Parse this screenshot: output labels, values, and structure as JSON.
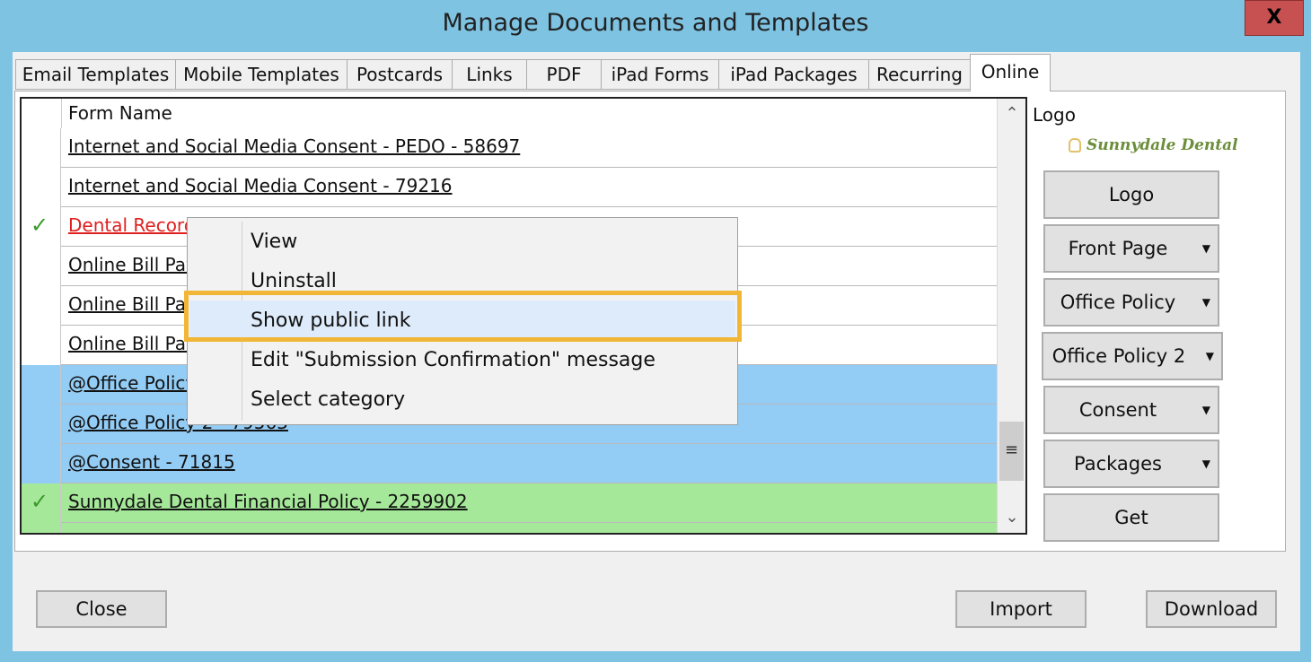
{
  "window": {
    "title": "Manage Documents and Templates",
    "close_glyph": "X"
  },
  "tabs": [
    {
      "label": "Email Templates"
    },
    {
      "label": "Mobile Templates"
    },
    {
      "label": "Postcards"
    },
    {
      "label": "Links"
    },
    {
      "label": "PDF"
    },
    {
      "label": "iPad Forms"
    },
    {
      "label": "iPad Packages"
    },
    {
      "label": "Recurring"
    },
    {
      "label": "Online",
      "active": true
    }
  ],
  "grid": {
    "header": "Form Name",
    "rows": [
      {
        "name": "Internet and Social Media Consent - PEDO - 58697",
        "style": "normal",
        "checked": false
      },
      {
        "name": "Internet and Social Media Consent - 79216",
        "style": "normal",
        "checked": false
      },
      {
        "name": "Dental Record",
        "style": "red",
        "checked": true
      },
      {
        "name": "Online Bill Pay",
        "style": "normal",
        "checked": false
      },
      {
        "name": "Online Bill Pay",
        "style": "normal",
        "checked": false
      },
      {
        "name": "Online Bill Pay",
        "style": "normal",
        "checked": false
      },
      {
        "name": "@Office Policy",
        "style": "blue",
        "checked": false
      },
      {
        "name": "@Office Policy 2 - 79563",
        "style": "blue",
        "checked": false
      },
      {
        "name": "@Consent - 71815",
        "style": "blue",
        "checked": false
      },
      {
        "name": "Sunnydale Dental Financial Policy - 2259902",
        "style": "green",
        "checked": true
      },
      {
        "name": "",
        "style": "green",
        "checked": true
      }
    ],
    "check_glyph": "✓",
    "scroll_up": "⌃",
    "scroll_down": "⌄",
    "scroll_thumb": "≡"
  },
  "side": {
    "logo_label": "Logo",
    "logo_text": "Sunnydale Dental",
    "buttons": [
      {
        "label": "Logo",
        "dropdown": false
      },
      {
        "label": "Front Page",
        "dropdown": true
      },
      {
        "label": "Office Policy",
        "dropdown": true
      },
      {
        "label": "Office Policy 2",
        "dropdown": true
      },
      {
        "label": "Consent",
        "dropdown": true
      },
      {
        "label": "Packages",
        "dropdown": true
      },
      {
        "label": "Get",
        "dropdown": false
      }
    ],
    "dropdown_glyph": "▼"
  },
  "footer": {
    "close": "Close",
    "import": "Import",
    "download": "Download"
  },
  "context_menu": {
    "items": [
      {
        "label": "View"
      },
      {
        "label": "Uninstall"
      },
      {
        "label": "Show public link",
        "highlighted": true
      },
      {
        "label": "Edit \"Submission Confirmation\" message"
      },
      {
        "label": "Select category"
      }
    ]
  }
}
